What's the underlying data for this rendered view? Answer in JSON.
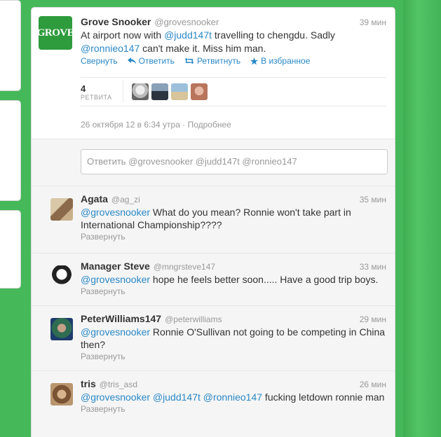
{
  "main_tweet": {
    "author_name": "Grove Snooker",
    "handle": "@grovesnooker",
    "time": "39 мин",
    "logo_text": "GROVE",
    "text_1": "At airport now with ",
    "mention_1": "@judd147t",
    "text_2": " travelling to chengdu. Sadly",
    "mention_2": "@ronnieo147",
    "text_3": " can't make it. Miss him man.",
    "actions": {
      "collapse": "Свернуть",
      "reply": "Ответить",
      "retweet": "Ретвитнуть",
      "favorite": "В избранное"
    },
    "retweets_count": "4",
    "retweets_label": "РЕТВИТА",
    "timestamp": "26 октября 12 в 6:34 утра",
    "details_link": "Подробнее"
  },
  "reply_box": {
    "placeholder": "Ответить @grovesnooker @judd147t @ronnieo147"
  },
  "replies": [
    {
      "name": "Agata",
      "handle": "@ag_zi",
      "time": "35 мин",
      "mention": "@grovesnooker",
      "text": " What do you mean? Ronnie won't take part in International Championship????",
      "expand": "Развернуть"
    },
    {
      "name": "Manager Steve",
      "handle": "@mngrsteve147",
      "time": "33 мин",
      "mention": "@grovesnooker",
      "text": " hope he feels better soon..... Have a good trip boys.",
      "expand": "Развернуть"
    },
    {
      "name": "PeterWilliams147",
      "handle": "@peterwilliams",
      "time": "29 мин",
      "mention": "@grovesnooker",
      "text": " Ronnie O'Sullivan not going to be competing in China then?",
      "expand": "Развернуть"
    },
    {
      "name": "tris",
      "handle": "@tris_asd",
      "time": "26 мин",
      "mention": "@grovesnooker",
      "mention_2": "@judd147t",
      "mention_3": "@ronnieo147",
      "text": " fucking letdown ronnie man",
      "expand": "Развернуть"
    }
  ],
  "colors": {
    "background": "#45b85a",
    "link": "#2a88c6",
    "muted": "#999999"
  }
}
